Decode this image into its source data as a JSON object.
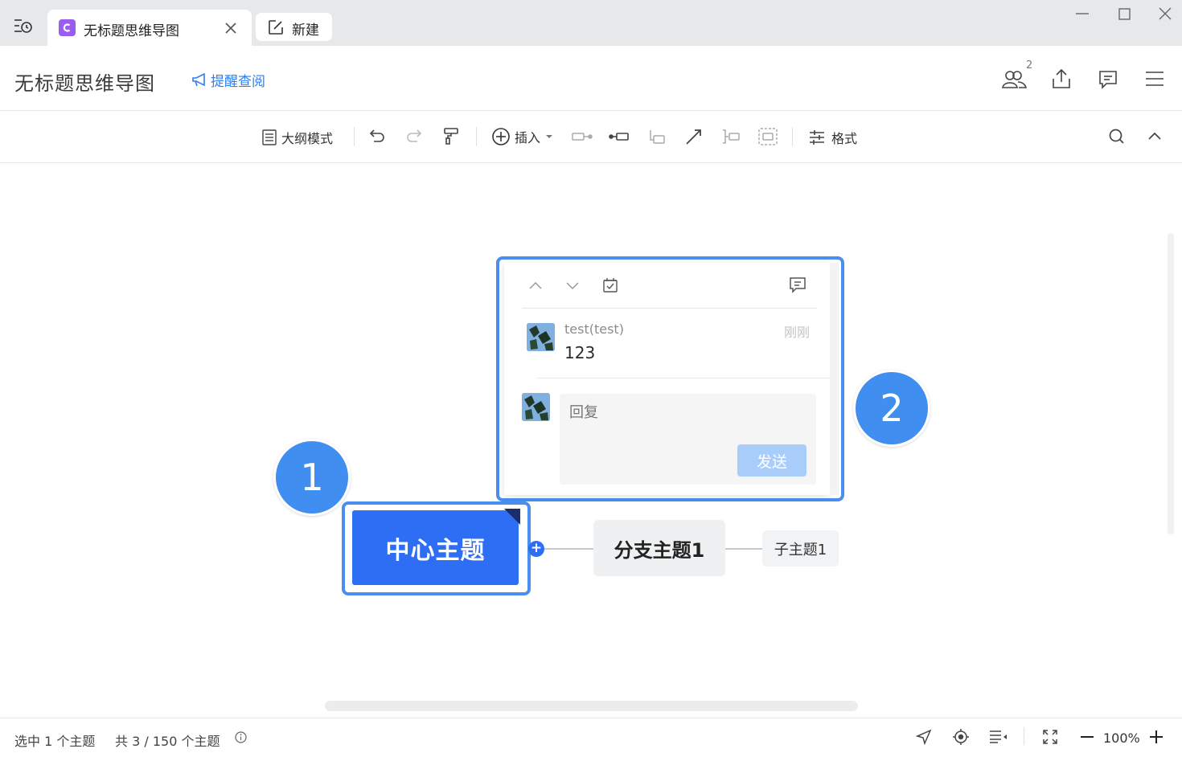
{
  "window": {
    "tabs": [
      {
        "label": "无标题思维导图",
        "icon": "mindmap-app-icon",
        "active": true
      },
      {
        "label": "新建",
        "icon": "new-document-icon",
        "active": false
      }
    ]
  },
  "header": {
    "title": "无标题思维导图",
    "remind_label": "提醒查阅",
    "collaborator_count": "2"
  },
  "toolbar": {
    "outline_mode": "大纲模式",
    "insert": "插入",
    "format": "格式"
  },
  "mindmap": {
    "central_topic": "中心主题",
    "branch_topic": "分支主题1",
    "sub_topic": "子主题1",
    "expand_symbol": "+"
  },
  "comment_popup": {
    "author": "test(test)",
    "time": "刚刚",
    "text": "123",
    "reply_placeholder": "回复",
    "send_label": "发送"
  },
  "markers": [
    "1",
    "2"
  ],
  "status": {
    "selected": "选中 1 个主题",
    "total": "共 3 / 150 个主题",
    "zoom": "100%"
  },
  "colors": {
    "accent": "#2d6ef5",
    "highlight": "#4a8ff0",
    "marker": "#3f8ef0",
    "link": "#2e7ef0",
    "send_button": "#a9cdfb"
  }
}
